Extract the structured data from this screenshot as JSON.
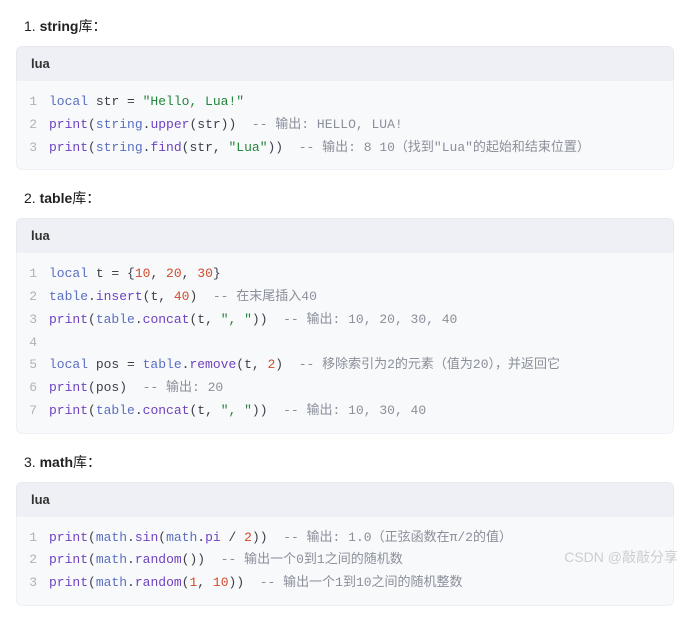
{
  "sections": [
    {
      "num": "1. ",
      "lib": "string",
      "suffix": "库：",
      "lang": "lua",
      "lines": [
        [
          {
            "t": "kw",
            "v": "local"
          },
          {
            "t": "plain",
            "v": " str = "
          },
          {
            "t": "str",
            "v": "\"Hello, Lua!\""
          }
        ],
        [
          {
            "t": "fn",
            "v": "print"
          },
          {
            "t": "plain",
            "v": "("
          },
          {
            "t": "kw",
            "v": "string"
          },
          {
            "t": "plain",
            "v": "."
          },
          {
            "t": "fn",
            "v": "upper"
          },
          {
            "t": "plain",
            "v": "(str))  "
          },
          {
            "t": "com",
            "v": "-- 输出: HELLO, LUA!"
          }
        ],
        [
          {
            "t": "fn",
            "v": "print"
          },
          {
            "t": "plain",
            "v": "("
          },
          {
            "t": "kw",
            "v": "string"
          },
          {
            "t": "plain",
            "v": "."
          },
          {
            "t": "fn",
            "v": "find"
          },
          {
            "t": "plain",
            "v": "(str, "
          },
          {
            "t": "str",
            "v": "\"Lua\""
          },
          {
            "t": "plain",
            "v": "))  "
          },
          {
            "t": "com",
            "v": "-- 输出: 8 10（找到\"Lua\"的起始和结束位置）"
          }
        ]
      ]
    },
    {
      "num": "2. ",
      "lib": "table",
      "suffix": "库：",
      "lang": "lua",
      "lines": [
        [
          {
            "t": "kw",
            "v": "local"
          },
          {
            "t": "plain",
            "v": " t = {"
          },
          {
            "t": "num-lit",
            "v": "10"
          },
          {
            "t": "plain",
            "v": ", "
          },
          {
            "t": "num-lit",
            "v": "20"
          },
          {
            "t": "plain",
            "v": ", "
          },
          {
            "t": "num-lit",
            "v": "30"
          },
          {
            "t": "plain",
            "v": "}"
          }
        ],
        [
          {
            "t": "kw",
            "v": "table"
          },
          {
            "t": "plain",
            "v": "."
          },
          {
            "t": "fn",
            "v": "insert"
          },
          {
            "t": "plain",
            "v": "(t, "
          },
          {
            "t": "num-lit",
            "v": "40"
          },
          {
            "t": "plain",
            "v": ")  "
          },
          {
            "t": "com",
            "v": "-- 在末尾插入40"
          }
        ],
        [
          {
            "t": "fn",
            "v": "print"
          },
          {
            "t": "plain",
            "v": "("
          },
          {
            "t": "kw",
            "v": "table"
          },
          {
            "t": "plain",
            "v": "."
          },
          {
            "t": "fn",
            "v": "concat"
          },
          {
            "t": "plain",
            "v": "(t, "
          },
          {
            "t": "str",
            "v": "\", \""
          },
          {
            "t": "plain",
            "v": "))  "
          },
          {
            "t": "com",
            "v": "-- 输出: 10, 20, 30, 40"
          }
        ],
        [],
        [
          {
            "t": "kw",
            "v": "local"
          },
          {
            "t": "plain",
            "v": " pos = "
          },
          {
            "t": "kw",
            "v": "table"
          },
          {
            "t": "plain",
            "v": "."
          },
          {
            "t": "fn",
            "v": "remove"
          },
          {
            "t": "plain",
            "v": "(t, "
          },
          {
            "t": "num-lit",
            "v": "2"
          },
          {
            "t": "plain",
            "v": ")  "
          },
          {
            "t": "com",
            "v": "-- 移除索引为2的元素（值为20），并返回它"
          }
        ],
        [
          {
            "t": "fn",
            "v": "print"
          },
          {
            "t": "plain",
            "v": "(pos)  "
          },
          {
            "t": "com",
            "v": "-- 输出: 20"
          }
        ],
        [
          {
            "t": "fn",
            "v": "print"
          },
          {
            "t": "plain",
            "v": "("
          },
          {
            "t": "kw",
            "v": "table"
          },
          {
            "t": "plain",
            "v": "."
          },
          {
            "t": "fn",
            "v": "concat"
          },
          {
            "t": "plain",
            "v": "(t, "
          },
          {
            "t": "str",
            "v": "\", \""
          },
          {
            "t": "plain",
            "v": "))  "
          },
          {
            "t": "com",
            "v": "-- 输出: 10, 30, 40"
          }
        ]
      ]
    },
    {
      "num": "3. ",
      "lib": "math",
      "suffix": "库：",
      "lang": "lua",
      "lines": [
        [
          {
            "t": "fn",
            "v": "print"
          },
          {
            "t": "plain",
            "v": "("
          },
          {
            "t": "kw",
            "v": "math"
          },
          {
            "t": "plain",
            "v": "."
          },
          {
            "t": "fn",
            "v": "sin"
          },
          {
            "t": "plain",
            "v": "("
          },
          {
            "t": "kw",
            "v": "math"
          },
          {
            "t": "plain",
            "v": "."
          },
          {
            "t": "fn",
            "v": "pi"
          },
          {
            "t": "plain",
            "v": " / "
          },
          {
            "t": "num-lit",
            "v": "2"
          },
          {
            "t": "plain",
            "v": "))  "
          },
          {
            "t": "com",
            "v": "-- 输出: 1.0（正弦函数在π/2的值）"
          }
        ],
        [
          {
            "t": "fn",
            "v": "print"
          },
          {
            "t": "plain",
            "v": "("
          },
          {
            "t": "kw",
            "v": "math"
          },
          {
            "t": "plain",
            "v": "."
          },
          {
            "t": "fn",
            "v": "random"
          },
          {
            "t": "plain",
            "v": "())  "
          },
          {
            "t": "com",
            "v": "-- 输出一个0到1之间的随机数"
          }
        ],
        [
          {
            "t": "fn",
            "v": "print"
          },
          {
            "t": "plain",
            "v": "("
          },
          {
            "t": "kw",
            "v": "math"
          },
          {
            "t": "plain",
            "v": "."
          },
          {
            "t": "fn",
            "v": "random"
          },
          {
            "t": "plain",
            "v": "("
          },
          {
            "t": "num-lit",
            "v": "1"
          },
          {
            "t": "plain",
            "v": ", "
          },
          {
            "t": "num-lit",
            "v": "10"
          },
          {
            "t": "plain",
            "v": "))  "
          },
          {
            "t": "com",
            "v": "-- 输出一个1到10之间的随机整数"
          }
        ]
      ]
    }
  ],
  "watermark": "CSDN @敲敲分享"
}
